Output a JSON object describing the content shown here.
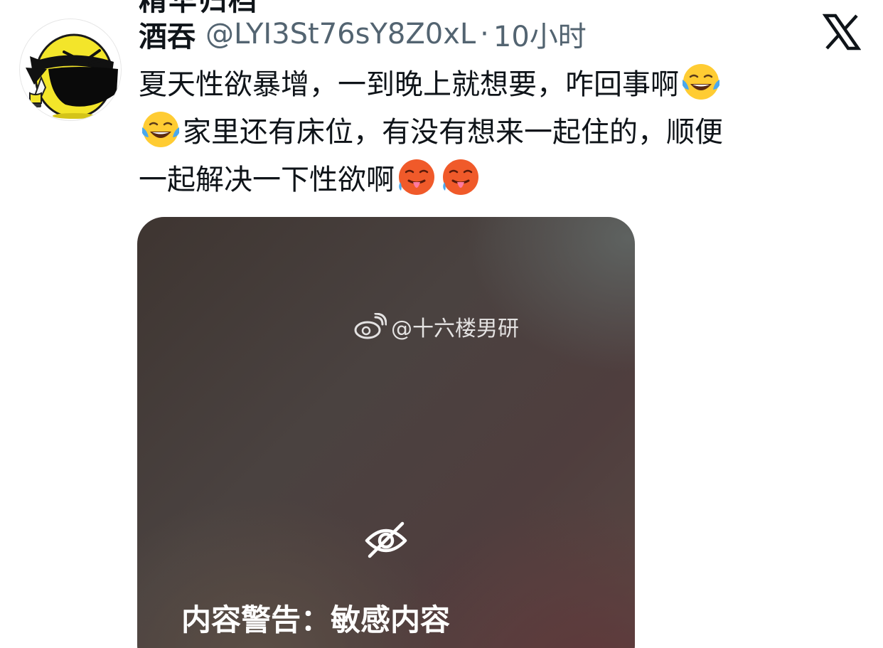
{
  "clipped_top_text": "精华归档",
  "user": {
    "display_name": "酒吞",
    "handle": "@LYI3St76sY8Z0xL",
    "separator": "·",
    "time": "10小时"
  },
  "tweet": {
    "line1": "夏天性欲暴增，一到晚上就想要，咋回事啊",
    "line2": "家里还有床位，有没有想来一起住的，顺便",
    "line3": "一起解决一下性欲啊"
  },
  "media": {
    "watermark": "@十六楼男研",
    "content_warning": "内容警告：敏感内容"
  },
  "icons": {
    "brand": "x-logo-icon",
    "laugh": "tears-of-joy-emoji-icon",
    "hot": "hot-face-emoji-icon",
    "weibo": "weibo-icon",
    "hidden": "eye-slash-icon"
  },
  "colors": {
    "text": "#0f1419",
    "secondary": "#536471",
    "media_overlay": "#4a4240",
    "avatar_yellow": "#f3e52a"
  }
}
